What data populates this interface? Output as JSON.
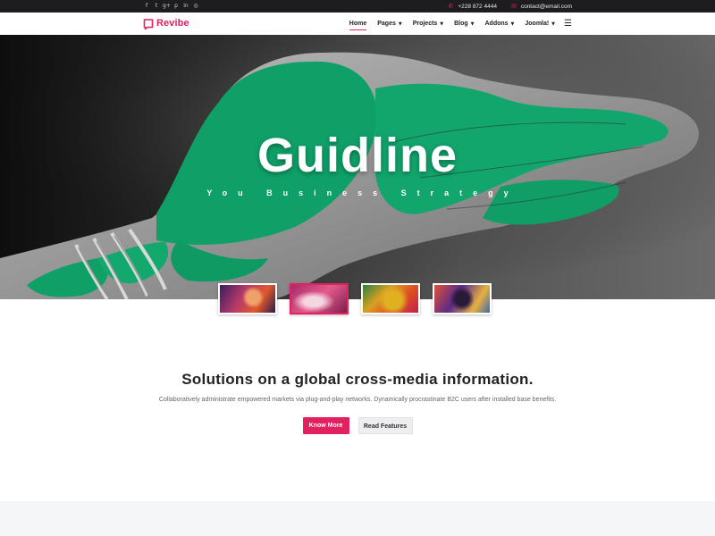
{
  "topbar": {
    "social_icons": [
      {
        "name": "facebook-icon",
        "glyph": "f"
      },
      {
        "name": "twitter-icon",
        "glyph": "t"
      },
      {
        "name": "google-plus-icon",
        "glyph": "g+"
      },
      {
        "name": "pinterest-icon",
        "glyph": "p"
      },
      {
        "name": "linkedin-icon",
        "glyph": "in"
      },
      {
        "name": "dribbble-icon",
        "glyph": "◎"
      }
    ],
    "phone": "+228 872 4444",
    "email": "contact@email.com"
  },
  "header": {
    "logo_text": "Revibe",
    "nav": [
      {
        "label": "Home",
        "active": true,
        "dropdown": false
      },
      {
        "label": "Pages",
        "active": false,
        "dropdown": true
      },
      {
        "label": "Projects",
        "active": false,
        "dropdown": true
      },
      {
        "label": "Blog",
        "active": false,
        "dropdown": true
      },
      {
        "label": "Addons",
        "active": false,
        "dropdown": true
      },
      {
        "label": "Joomla!",
        "active": false,
        "dropdown": true
      }
    ],
    "menu_icon": "hamburger-menu-icon"
  },
  "hero": {
    "title": "Guidline",
    "subtitle": "You Business Strategy"
  },
  "slider": {
    "active_index": 1,
    "thumbnails": [
      "slide-1",
      "slide-2",
      "slide-3",
      "slide-4"
    ]
  },
  "intro": {
    "title": "Solutions on a global cross-media information.",
    "text": "Collaboratively administrate empowered markets via plug-and-play networks. Dynamically procrastinate B2C users after installed base benefits.",
    "primary_button": "Know More",
    "secondary_button": "Read Features"
  },
  "colors": {
    "accent": "#e2215f",
    "topbar_bg": "#1d1d1f",
    "hero_green": "#12a06a",
    "footer_band": "#f5f6f8"
  }
}
